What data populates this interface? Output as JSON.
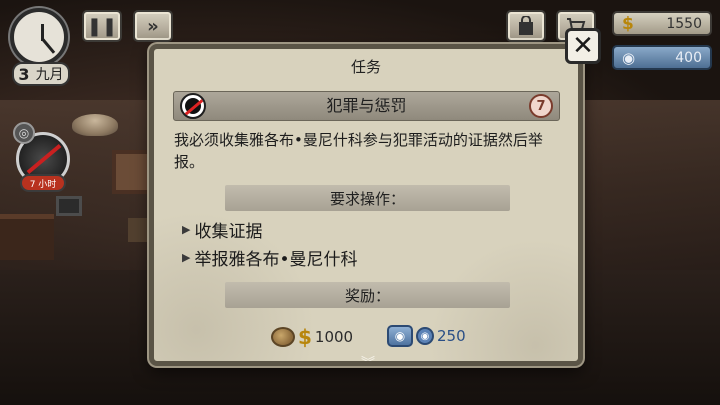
{
  "hud": {
    "date_day": "3",
    "date_month": "九月",
    "pause_glyph": "❚❚",
    "ff_glyph": "»",
    "money_symbol": "$",
    "money_value": "1550",
    "reputation_symbol": "◉",
    "reputation_value": "400",
    "shop_icon": "shopping-bag-icon",
    "cart_icon": "cart-icon"
  },
  "character": {
    "medal_glyph": "◎",
    "timer_text": "7 小时"
  },
  "modal": {
    "title": "任务",
    "close_glyph": "✕",
    "quest": {
      "name": "犯罪与惩罚",
      "number": "7"
    },
    "description": "我必须收集雅各布•曼尼什科参与犯罪活动的证据然后举报。",
    "requirements_label": "要求操作：",
    "actions": [
      {
        "arrow": "▶",
        "label": "收集证据"
      },
      {
        "arrow": "▶",
        "label": "举报雅各布•曼尼什科"
      }
    ],
    "rewards_label": "奖励：",
    "reward_money": {
      "symbol": "$",
      "value": "1000"
    },
    "reward_reputation": {
      "symbol": "◉",
      "value": "250"
    },
    "more_glyph": "︾"
  }
}
